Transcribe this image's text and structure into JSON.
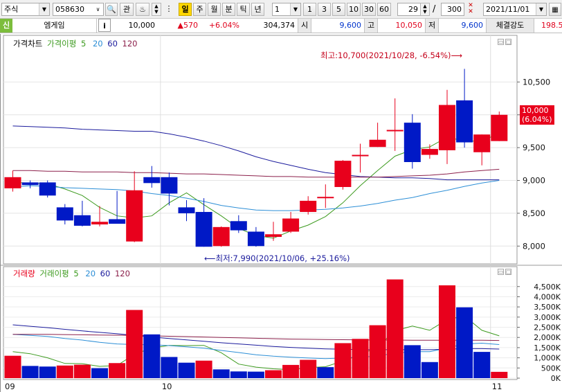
{
  "toolbar": {
    "market_type": "주식",
    "stock_code": "058630",
    "watch_label": "관",
    "period_active": "일",
    "periods": [
      "주",
      "월",
      "분",
      "틱",
      "년"
    ],
    "interval_value": "1",
    "interval_options": [
      "1",
      "3",
      "5",
      "10",
      "30",
      "60"
    ],
    "view_count": "29",
    "total_count": "300",
    "date": "2021/11/01"
  },
  "info": {
    "credit_badge": "신",
    "stock_name": "엠게임",
    "info_button": "i",
    "price": "10,000",
    "change": "▲570",
    "change_pct": "+6.04%",
    "volume": "304,374",
    "open_label": "시",
    "open": "9,600",
    "high_label": "고",
    "high": "10,050",
    "low_label": "저",
    "low": "9,600",
    "strength_label": "체결강도",
    "strength": "198.5"
  },
  "price_panel": {
    "legend": {
      "title": "가격차트",
      "ma_label": "가격이평",
      "ma_periods": [
        "5",
        "20",
        "60",
        "120"
      ]
    },
    "last_price": "10,000",
    "last_change": "(6.04%)",
    "max_annotation": "최고:10,700(2021/10/28, -6.54%)",
    "min_annotation": "최저:7,990(2021/10/06, +25.16%)"
  },
  "volume_panel": {
    "legend": {
      "title": "거래량",
      "ma_label": "거래이평",
      "ma_periods": [
        "5",
        "20",
        "60",
        "120"
      ]
    }
  },
  "colors": {
    "up": "#e8001c",
    "down": "#0019c6",
    "ma5": "#3c9a1e",
    "ma20": "#2b8ed6",
    "ma60": "#1a1a9c",
    "ma120": "#8b1f4a"
  },
  "chart_data": [
    {
      "type": "candlestick",
      "title": "가격차트",
      "x_tick_labels": [
        "09",
        "10",
        "11"
      ],
      "x_tick_index": [
        0,
        9,
        28
      ],
      "y_ticks": [
        8000,
        8500,
        9000,
        9500,
        10000,
        10500
      ],
      "y_tick_labels": [
        "8,000",
        "8,500",
        "9,000",
        "9,500",
        "10,000",
        "10,500"
      ],
      "ylim": [
        7750,
        11000
      ],
      "candles": [
        {
          "o": 8880,
          "h": 9150,
          "l": 8830,
          "c": 9050
        },
        {
          "o": 8970,
          "h": 9000,
          "l": 8880,
          "c": 8930
        },
        {
          "o": 8970,
          "h": 9000,
          "l": 8740,
          "c": 8770
        },
        {
          "o": 8590,
          "h": 8640,
          "l": 8330,
          "c": 8390
        },
        {
          "o": 8470,
          "h": 8690,
          "l": 8300,
          "c": 8310
        },
        {
          "o": 8330,
          "h": 8610,
          "l": 8300,
          "c": 8370
        },
        {
          "o": 8410,
          "h": 8840,
          "l": 8350,
          "c": 8340
        },
        {
          "o": 8070,
          "h": 9140,
          "l": 8060,
          "c": 8850
        },
        {
          "o": 9050,
          "h": 9220,
          "l": 8890,
          "c": 8960
        },
        {
          "o": 9050,
          "h": 9120,
          "l": 8620,
          "c": 8800
        },
        {
          "o": 8590,
          "h": 8700,
          "l": 8380,
          "c": 8500
        },
        {
          "o": 8520,
          "h": 8730,
          "l": 7990,
          "c": 7990
        },
        {
          "o": 8000,
          "h": 8300,
          "l": 7990,
          "c": 8290
        },
        {
          "o": 8380,
          "h": 8470,
          "l": 8200,
          "c": 8240
        },
        {
          "o": 8220,
          "h": 8290,
          "l": 7990,
          "c": 8000
        },
        {
          "o": 8140,
          "h": 8370,
          "l": 8080,
          "c": 8180
        },
        {
          "o": 8220,
          "h": 8520,
          "l": 8200,
          "c": 8420
        },
        {
          "o": 8520,
          "h": 8760,
          "l": 8480,
          "c": 8690
        },
        {
          "o": 8740,
          "h": 8940,
          "l": 8580,
          "c": 8750
        },
        {
          "o": 8900,
          "h": 9310,
          "l": 8860,
          "c": 9300
        },
        {
          "o": 9370,
          "h": 9560,
          "l": 9120,
          "c": 9390
        },
        {
          "o": 9510,
          "h": 9880,
          "l": 9510,
          "c": 9620
        },
        {
          "o": 9770,
          "h": 10250,
          "l": 9450,
          "c": 9770
        },
        {
          "o": 9880,
          "h": 10010,
          "l": 9180,
          "c": 9280
        },
        {
          "o": 9390,
          "h": 9550,
          "l": 9330,
          "c": 9480
        },
        {
          "o": 9460,
          "h": 10380,
          "l": 9250,
          "c": 10150
        },
        {
          "o": 10220,
          "h": 10700,
          "l": 9500,
          "c": 9580
        },
        {
          "o": 9430,
          "h": 9700,
          "l": 9230,
          "c": 9700
        },
        {
          "o": 9600,
          "h": 10050,
          "l": 9600,
          "c": 10000
        }
      ],
      "series": [
        {
          "name": "5",
          "values": [
            8970,
            8960,
            8950,
            8870,
            8770,
            8590,
            8460,
            8430,
            8460,
            8660,
            8810,
            8630,
            8460,
            8270,
            8160,
            8120,
            8230,
            8320,
            8450,
            8660,
            8920,
            9150,
            9370,
            9470,
            9510,
            9660,
            9600,
            9600,
            9720
          ]
        },
        {
          "name": "20",
          "values": [
            8900,
            8920,
            8910,
            8890,
            8880,
            8870,
            8860,
            8840,
            8800,
            8770,
            8730,
            8680,
            8620,
            8580,
            8550,
            8540,
            8540,
            8550,
            8560,
            8580,
            8610,
            8650,
            8700,
            8740,
            8800,
            8850,
            8910,
            8960,
            9000
          ]
        },
        {
          "name": "60",
          "values": [
            9830,
            9820,
            9810,
            9800,
            9780,
            9770,
            9760,
            9750,
            9750,
            9710,
            9660,
            9600,
            9530,
            9450,
            9360,
            9290,
            9230,
            9170,
            9120,
            9090,
            9060,
            9050,
            9040,
            9040,
            9030,
            9010,
            9010,
            9010,
            9010
          ]
        },
        {
          "name": "120",
          "values": [
            9150,
            9150,
            9140,
            9140,
            9130,
            9130,
            9130,
            9120,
            9120,
            9110,
            9100,
            9100,
            9090,
            9080,
            9070,
            9060,
            9060,
            9050,
            9050,
            9050,
            9050,
            9050,
            9060,
            9070,
            9080,
            9100,
            9130,
            9150,
            9170
          ]
        }
      ]
    },
    {
      "type": "bar",
      "title": "거래량",
      "y_ticks": [
        0,
        500,
        1000,
        1500,
        2000,
        2500,
        3000,
        3500,
        4000,
        4500
      ],
      "y_tick_labels": [
        "0K",
        "500K",
        "1,000K",
        "1,500K",
        "2,000K",
        "2,500K",
        "3,000K",
        "3,500K",
        "4,000K",
        "4,500K"
      ],
      "ylim": [
        0,
        4900
      ],
      "values": [
        1100,
        600,
        570,
        620,
        660,
        490,
        740,
        3350,
        2150,
        1040,
        760,
        860,
        430,
        330,
        320,
        390,
        650,
        900,
        540,
        1720,
        1930,
        2600,
        4850,
        1620,
        790,
        4560,
        3480,
        1290,
        310
      ],
      "up": [
        true,
        false,
        false,
        true,
        true,
        false,
        true,
        true,
        false,
        false,
        false,
        true,
        false,
        false,
        false,
        true,
        true,
        true,
        false,
        true,
        true,
        true,
        true,
        false,
        false,
        true,
        false,
        false,
        true
      ],
      "series": [
        {
          "name": "5",
          "values": [
            1300,
            1200,
            1000,
            720,
            710,
            580,
            620,
            1170,
            1480,
            1610,
            1600,
            1610,
            1250,
            690,
            540,
            460,
            420,
            520,
            560,
            840,
            1150,
            1530,
            2330,
            2560,
            2350,
            2880,
            3050,
            2350,
            2080
          ]
        },
        {
          "name": "20",
          "values": [
            2150,
            2100,
            2050,
            1950,
            1870,
            1760,
            1680,
            1650,
            1640,
            1600,
            1540,
            1470,
            1360,
            1260,
            1150,
            1080,
            1030,
            990,
            960,
            990,
            1030,
            1090,
            1230,
            1300,
            1300,
            1480,
            1680,
            1720,
            1650
          ]
        },
        {
          "name": "60",
          "values": [
            2620,
            2550,
            2480,
            2400,
            2320,
            2250,
            2180,
            2100,
            2020,
            1950,
            1880,
            1810,
            1740,
            1680,
            1620,
            1560,
            1510,
            1470,
            1440,
            1420,
            1410,
            1400,
            1400,
            1400,
            1400,
            1420,
            1450,
            1450,
            1430
          ]
        },
        {
          "name": "120",
          "values": [
            2150,
            2150,
            2150,
            2140,
            2130,
            2120,
            2110,
            2100,
            2080,
            2060,
            2040,
            2020,
            2000,
            1980,
            1960,
            1940,
            1920,
            1910,
            1900,
            1890,
            1880,
            1870,
            1870,
            1860,
            1860,
            1860,
            1860,
            1860,
            1850
          ]
        }
      ]
    }
  ]
}
